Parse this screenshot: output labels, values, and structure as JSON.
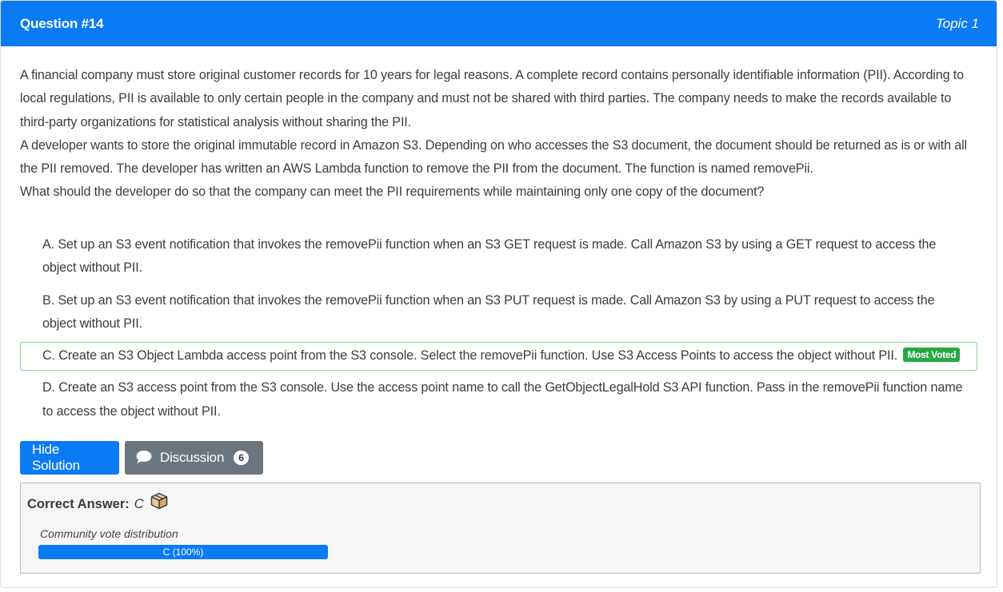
{
  "header": {
    "question_title": "Question #14",
    "topic": "Topic 1"
  },
  "question": {
    "paragraphs": [
      "A financial company must store original customer records for 10 years for legal reasons. A complete record contains personally identifiable information (PII). According to local regulations, PII is available to only certain people in the company and must not be shared with third parties. The company needs to make the records available to third-party organizations for statistical analysis without sharing the PII.",
      "A developer wants to store the original immutable record in Amazon S3. Depending on who accesses the S3 document, the document should be returned as is or with all the PII removed. The developer has written an AWS Lambda function to remove the PII from the document. The function is named removePii.",
      "What should the developer do so that the company can meet the PII requirements while maintaining only one copy of the document?"
    ]
  },
  "choices": [
    {
      "text": "A. Set up an S3 event notification that invokes the removePii function when an S3 GET request is made. Call Amazon S3 by using a GET request to access the object without PII."
    },
    {
      "text": "B. Set up an S3 event notification that invokes the removePii function when an S3 PUT request is made. Call Amazon S3 by using a PUT request to access the object without PII."
    },
    {
      "text": "C. Create an S3 Object Lambda access point from the S3 console. Select the removePii function. Use S3 Access Points to access the object without PII.",
      "badge": "Most Voted"
    },
    {
      "text": "D. Create an S3 access point from the S3 console. Use the access point name to call the GetObjectLegalHold S3 API function. Pass in the removePii function name to access the object without PII."
    }
  ],
  "buttons": {
    "hide_solution": "Hide Solution",
    "discussion": "Discussion",
    "discussion_count": "6"
  },
  "answer": {
    "label": "Correct Answer:",
    "value": "C",
    "vote_label": "Community vote distribution",
    "vote_bar_text": "C (100%)",
    "vote_fraction": 1.0
  },
  "colors": {
    "primary": "#0a7bf5",
    "secondary": "#6c757d",
    "success": "#28a745"
  },
  "icons": {
    "discussion": "chat-bubble-icon",
    "answer": "package-box-icon"
  }
}
